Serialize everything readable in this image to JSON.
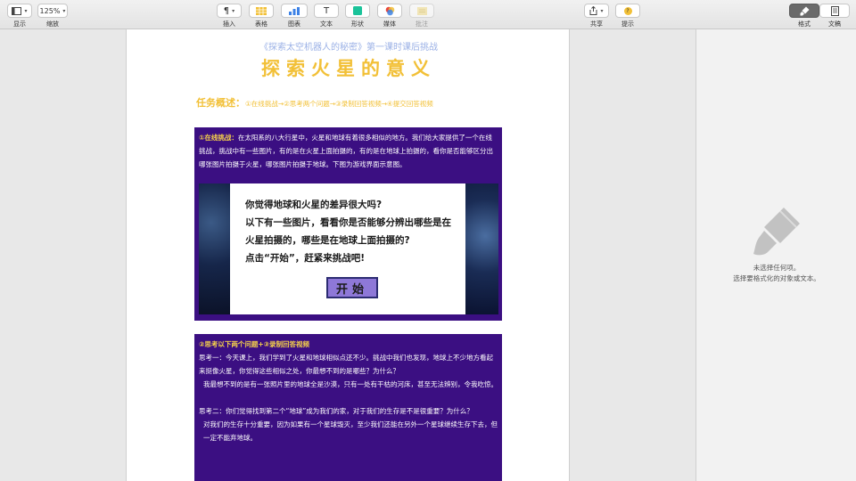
{
  "toolbar": {
    "view_label": "显示",
    "zoom_value": "125%",
    "zoom_label": "缩放",
    "insert_label": "插入",
    "table_label": "表格",
    "chart_label": "图表",
    "text_label": "文本",
    "shape_label": "形状",
    "media_label": "媒体",
    "comment_label": "批注",
    "share_label": "共享",
    "tips_label": "提示",
    "format_label": "格式",
    "document_label": "文稿",
    "insert_glyph": "¶",
    "text_glyph": "T",
    "tips_glyph": "?"
  },
  "document": {
    "subtitle": "《探索太空机器人的秘密》第一课时课后挑战",
    "title": "探索火星的意义",
    "task_label": "任务概述：",
    "task_steps": "①在线挑战→②思考两个问题→③录制回答视频→④提交回答视频",
    "section1": {
      "heading": "①在线挑战：",
      "body": "在太阳系的八大行星中，火星和地球有着很多相似的地方。我们给大家提供了一个在线挑战，挑战中有一些图片，有的是在火星上面拍摄的，有的是在地球上拍摄的，看你是否能够区分出哪张图片拍摄于火星，哪张图片拍摄于地球。下图为游戏界面示意图。",
      "game": {
        "line1": "你觉得地球和火星的差异很大吗?",
        "line2": "以下有一些图片，看看你是否能够分辨出哪些是在",
        "line3": "火星拍摄的，哪些是在地球上面拍摄的?",
        "line4": "点击“开始”，赶紧来挑战吧!",
        "start_button": "开始"
      }
    },
    "section2": {
      "heading": "②思考以下两个问题+③录制回答视频",
      "q1": "思考一：今天课上，我们学到了火星和地球相似点还不少。挑战中我们也发现，地球上不少地方看起来挺像火星，你觉得这些相似之处，你最想不到的是哪些？为什么？",
      "a1": "我最想不到的是有一张照片里的地球全是沙漠，只有一处有干枯的河床，甚至无法辨别，令我吃惊。",
      "q2": "思考二：你们觉得找到第二个“地球”成为我们的家，对于我们的生存是不是很重要？为什么？",
      "a2": "对我们的生存十分重要，因为如果有一个星球毁灭，至少我们还能在另外一个星球继续生存下去，但一定不能弃地球。"
    }
  },
  "inspector": {
    "empty_line1": "未选择任何项。",
    "empty_line2": "选择要格式化的对象或文本。"
  },
  "colors": {
    "section_bg": "#3b0f82",
    "title": "#f2c037",
    "subtitle": "#9bb1e6",
    "highlight": "#f7d34a",
    "start_button": "#8e78d8"
  }
}
